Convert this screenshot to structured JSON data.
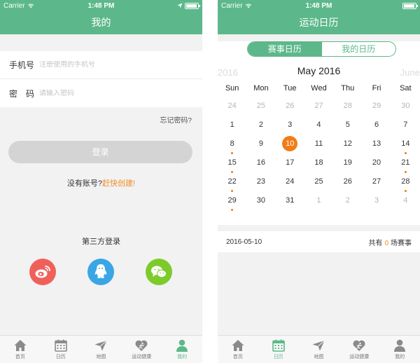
{
  "status": {
    "carrier": "Carrier",
    "time": "1:48 PM"
  },
  "login": {
    "title": "我的",
    "phone_label": "手机号",
    "phone_placeholder": "注册使用的手机号",
    "password_label": "密　码",
    "password_placeholder": "请输入密码",
    "forgot": "忘记密码?",
    "login_button": "登录",
    "no_account": "没有账号?",
    "register_link": "赶快创建!",
    "third_party_title": "第三方登录",
    "third_party": [
      {
        "icon": "weibo-icon",
        "color": "#f0605a"
      },
      {
        "icon": "qq-icon",
        "color": "#3aa6e6"
      },
      {
        "icon": "wechat-icon",
        "color": "#7ccb2a"
      }
    ]
  },
  "calendar": {
    "title": "运动日历",
    "segments": [
      "赛事日历",
      "我的日历"
    ],
    "prev_label": "2016",
    "month_label": "May 2016",
    "next_label": "June",
    "weekdays": [
      "Sun",
      "Mon",
      "Tue",
      "Wed",
      "Thu",
      "Fri",
      "Sat"
    ],
    "weeks": [
      [
        {
          "d": "24",
          "o": true
        },
        {
          "d": "25",
          "o": true
        },
        {
          "d": "26",
          "o": true
        },
        {
          "d": "27",
          "o": true
        },
        {
          "d": "28",
          "o": true
        },
        {
          "d": "29",
          "o": true
        },
        {
          "d": "30",
          "o": true
        }
      ],
      [
        {
          "d": "1"
        },
        {
          "d": "2"
        },
        {
          "d": "3"
        },
        {
          "d": "4"
        },
        {
          "d": "5"
        },
        {
          "d": "6"
        },
        {
          "d": "7"
        }
      ],
      [
        {
          "d": "8",
          "e": true
        },
        {
          "d": "9"
        },
        {
          "d": "10",
          "s": true
        },
        {
          "d": "11"
        },
        {
          "d": "12"
        },
        {
          "d": "13"
        },
        {
          "d": "14",
          "e": true
        }
      ],
      [
        {
          "d": "15",
          "e": true
        },
        {
          "d": "16"
        },
        {
          "d": "17"
        },
        {
          "d": "18"
        },
        {
          "d": "19"
        },
        {
          "d": "20"
        },
        {
          "d": "21",
          "e": true
        }
      ],
      [
        {
          "d": "22",
          "e": true
        },
        {
          "d": "23"
        },
        {
          "d": "24"
        },
        {
          "d": "25"
        },
        {
          "d": "26"
        },
        {
          "d": "27"
        },
        {
          "d": "28",
          "e": true
        }
      ],
      [
        {
          "d": "29",
          "e": true
        },
        {
          "d": "30"
        },
        {
          "d": "31"
        },
        {
          "d": "1",
          "o": true
        },
        {
          "d": "2",
          "o": true
        },
        {
          "d": "3",
          "o": true
        },
        {
          "d": "4",
          "o": true
        }
      ]
    ],
    "selected_date": "2016-05-10",
    "count_prefix": "共有",
    "count": "0",
    "count_suffix": "场赛事"
  },
  "tabs": [
    {
      "label": "首页",
      "icon": "home-icon"
    },
    {
      "label": "日历",
      "icon": "calendar-icon"
    },
    {
      "label": "地图",
      "icon": "paper-plane-icon"
    },
    {
      "label": "运动健康",
      "icon": "heart-runner-icon"
    },
    {
      "label": "我的",
      "icon": "person-icon"
    }
  ],
  "colors": {
    "brand": "#5cb88a",
    "accent": "#f07d16",
    "tab_inactive": "#888888"
  }
}
